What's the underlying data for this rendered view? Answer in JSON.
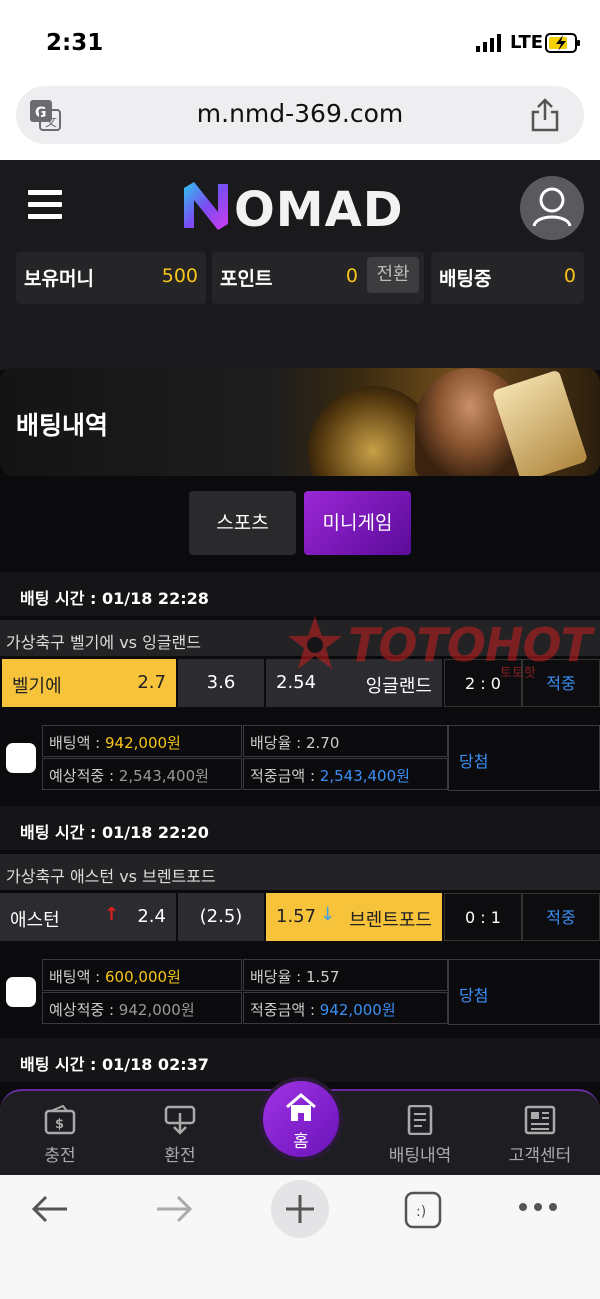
{
  "status": {
    "time": "2:31",
    "network": "LTE"
  },
  "browser": {
    "url": "m.nmd-369.com"
  },
  "header": {
    "logo": "NOMAD",
    "balances": [
      {
        "label": "보유머니",
        "value": "500"
      },
      {
        "label": "포인트",
        "value": "0",
        "action": "전환"
      },
      {
        "label": "배팅중",
        "value": "0"
      }
    ]
  },
  "banner": {
    "title": "배팅내역"
  },
  "tabs": [
    {
      "label": "스포츠"
    },
    {
      "label": "미니게임"
    }
  ],
  "bets": [
    {
      "time": "배팅 시간 : 01/18 22:28",
      "match": "가상축구 벨기에 vs 잉글랜드",
      "home": "벨기에",
      "home_odds": "2.7",
      "draw": "3.6",
      "away_odds": "2.54",
      "away": "잉글랜드",
      "score": "2 : 0",
      "result": "적중",
      "amount_label": "배팅액 : ",
      "amount": "942,000원",
      "rate_label": "배당율 : ",
      "rate": "2.70",
      "expected_label": "예상적중 : ",
      "expected": "2,543,400원",
      "payout_label": "적중금액 : ",
      "payout": "2,543,400원",
      "status": "당첨"
    },
    {
      "time": "배팅 시간 : 01/18 22:20",
      "match": "가상축구 애스턴 vs 브렌트포드",
      "home": "애스턴",
      "home_odds": "2.4",
      "draw": "(2.5)",
      "away_odds": "1.57",
      "away": "브렌트포드",
      "score": "0 : 1",
      "result": "적중",
      "amount_label": "배팅액 : ",
      "amount": "600,000원",
      "rate_label": "배당율 : ",
      "rate": "1.57",
      "expected_label": "예상적중 : ",
      "expected": "942,000원",
      "payout_label": "적중금액 : ",
      "payout": "942,000원",
      "status": "당첨"
    },
    {
      "time": "배팅 시간 : 01/18 02:37"
    }
  ],
  "watermark": {
    "text": "TOTOHOT",
    "sub": "토토핫"
  },
  "nav": [
    {
      "label": "충전",
      "icon": "wallet-icon"
    },
    {
      "label": "환전",
      "icon": "exchange-icon"
    },
    {
      "label": "홈",
      "icon": "home-icon"
    },
    {
      "label": "배팅내역",
      "icon": "document-icon"
    },
    {
      "label": "고객센터",
      "icon": "newspaper-icon"
    }
  ],
  "colors": {
    "accent": "#8e24d6",
    "gold": "#f5c518",
    "blue": "#3a8ff5"
  }
}
